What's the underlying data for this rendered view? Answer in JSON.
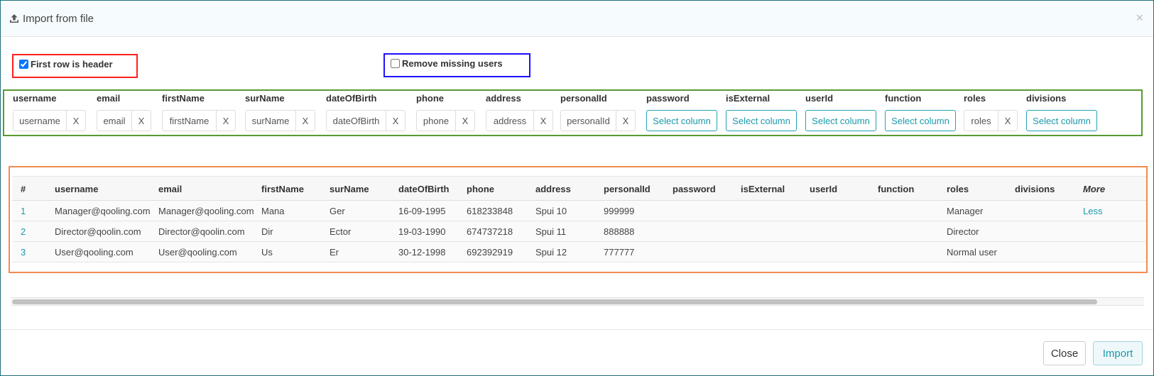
{
  "dialog": {
    "title": "Import from file",
    "close_symbol": "×",
    "icons": {
      "title_icon": "upload-icon",
      "close_icon": "close-icon"
    }
  },
  "options": {
    "first_row_header": {
      "label": "First row is header",
      "checked": true
    },
    "remove_missing": {
      "label": "Remove missing users",
      "checked": false
    }
  },
  "mapping": {
    "clear_label": "X",
    "select_label": "Select column",
    "columns": [
      {
        "name": "username",
        "mapped": "username"
      },
      {
        "name": "email",
        "mapped": "email"
      },
      {
        "name": "firstName",
        "mapped": "firstName"
      },
      {
        "name": "surName",
        "mapped": "surName"
      },
      {
        "name": "dateOfBirth",
        "mapped": "dateOfBirth"
      },
      {
        "name": "phone",
        "mapped": "phone"
      },
      {
        "name": "address",
        "mapped": "address"
      },
      {
        "name": "personalId",
        "mapped": "personalId"
      },
      {
        "name": "password",
        "mapped": null
      },
      {
        "name": "isExternal",
        "mapped": null
      },
      {
        "name": "userId",
        "mapped": null
      },
      {
        "name": "function",
        "mapped": null
      },
      {
        "name": "roles",
        "mapped": "roles"
      },
      {
        "name": "divisions",
        "mapped": null
      }
    ]
  },
  "preview": {
    "headers": [
      "#",
      "username",
      "email",
      "firstName",
      "surName",
      "dateOfBirth",
      "phone",
      "address",
      "personalId",
      "password",
      "isExternal",
      "userId",
      "function",
      "roles",
      "divisions",
      "More"
    ],
    "rows": [
      [
        "1",
        "Manager@qooling.com",
        "Manager@qooling.com",
        "Mana",
        "Ger",
        "16-09-1995",
        "618233848",
        "Spui 10",
        "999999",
        "",
        "",
        "",
        "",
        "Manager",
        "",
        "Less"
      ],
      [
        "2",
        "Director@qoolin.com",
        "Director@qoolin.com",
        "Dir",
        "Ector",
        "19-03-1990",
        "674737218",
        "Spui 11",
        "888888",
        "",
        "",
        "",
        "",
        "Director",
        "",
        ""
      ],
      [
        "3",
        "User@qooling.com",
        "User@qooling.com",
        "Us",
        "Er",
        "30-12-1998",
        "692392919",
        "Spui 12",
        "777777",
        "",
        "",
        "",
        "",
        "Normal user",
        "",
        ""
      ]
    ]
  },
  "footer": {
    "close_label": "Close",
    "import_label": "Import"
  },
  "colors": {
    "accent": "#1a9aab",
    "header_bg": "#f6fbfd"
  }
}
